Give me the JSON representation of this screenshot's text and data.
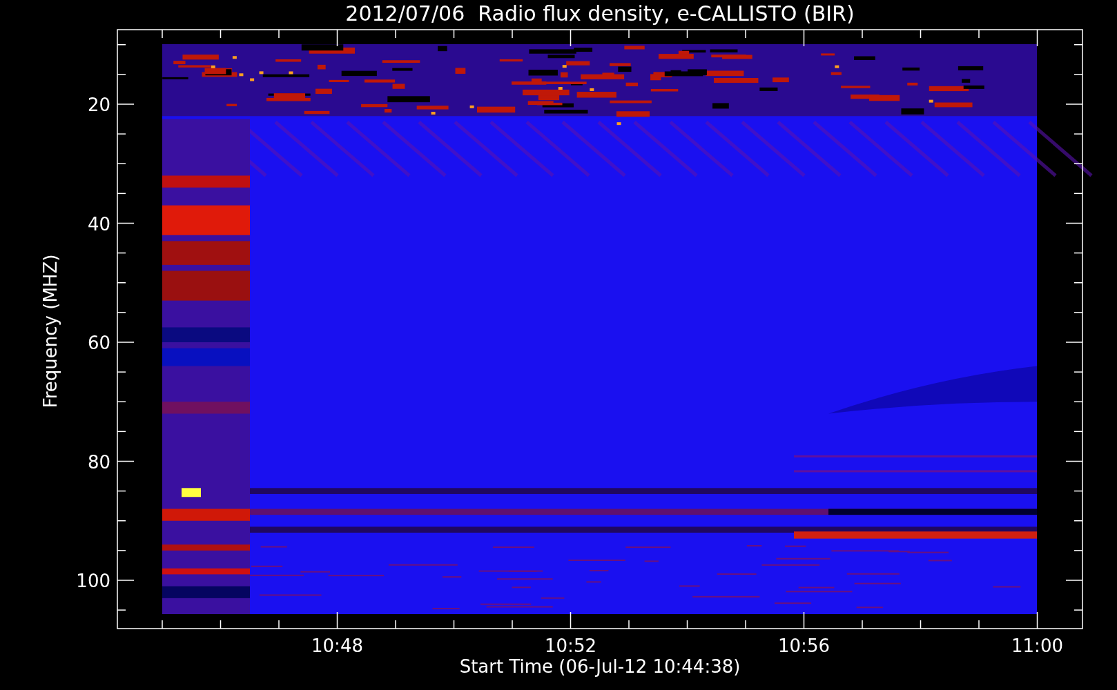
{
  "title": "2012/07/06  Radio flux density, e-CALLISTO (BIR)",
  "y_axis": {
    "label": "Frequency (MHZ)",
    "ticks": [
      "20",
      "40",
      "60",
      "80",
      "100"
    ]
  },
  "x_axis": {
    "label": "Start Time (06-Jul-12 10:44:38)",
    "ticks": [
      "10:48",
      "10:52",
      "10:56",
      "11:00"
    ]
  }
}
